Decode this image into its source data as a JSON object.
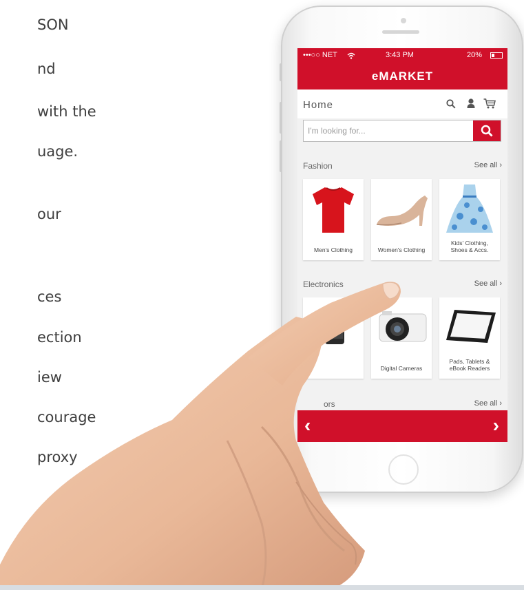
{
  "article": {
    "lines": [
      "SON",
      "nd",
      "with the",
      "uage.",
      "our",
      "ces",
      "ection",
      "iew",
      "courage",
      "proxy"
    ]
  },
  "phone": {
    "status": {
      "carrier": "•••○○ NET",
      "time": "3:43 PM",
      "battery": "20%"
    },
    "app_title": "eMARKET",
    "header": {
      "title": "Home"
    },
    "search": {
      "placeholder": "I'm looking for..."
    },
    "sections": [
      {
        "title": "Fashion",
        "see_all": "See all ›",
        "items": [
          "Men's Clothing",
          "Women's Clothing",
          "Kids' Clothing, Shoes & Accs."
        ]
      },
      {
        "title": "Electronics",
        "see_all": "See all ›",
        "items": [
          "",
          "Digital Cameras",
          "Pads, Tablets & eBook Readers"
        ]
      },
      {
        "title": "ors",
        "see_all": "See all ›"
      }
    ],
    "nav": {
      "prev": "‹",
      "next": "›"
    }
  },
  "colors": {
    "brand_red": "#d0102a"
  },
  "icons": [
    "search-icon",
    "user-icon",
    "cart-icon",
    "wifi-icon",
    "battery-icon",
    "chevron-left-icon",
    "chevron-right-icon"
  ]
}
